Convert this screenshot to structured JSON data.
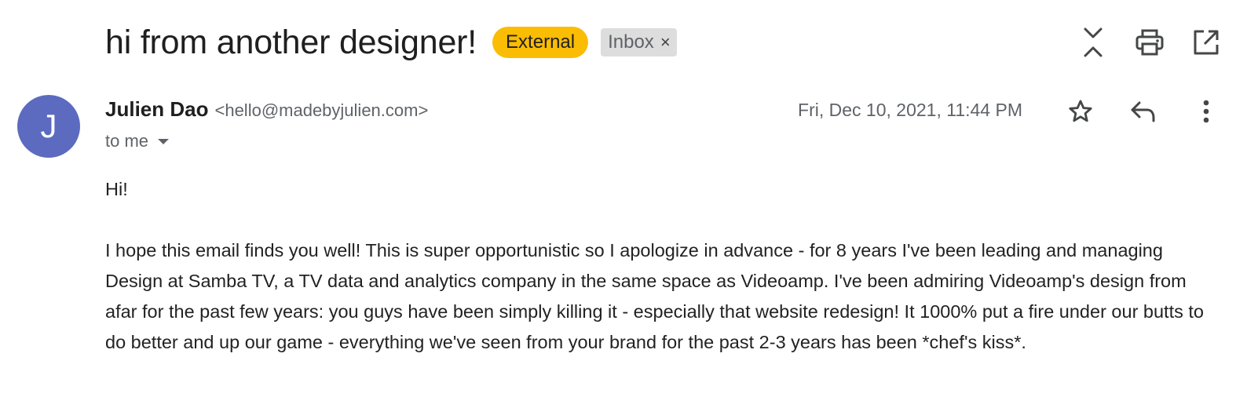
{
  "email": {
    "subject": "hi from another designer!",
    "labels": {
      "external": "External",
      "inbox": "Inbox",
      "remove": "×"
    },
    "sender": {
      "avatar_letter": "J",
      "name": "Julien Dao",
      "email": "<hello@madebyjulien.com>",
      "to": "to me"
    },
    "date": "Fri, Dec 10, 2021, 11:44 PM",
    "body": {
      "greeting": "Hi!",
      "paragraph": "I hope this email finds you well! This is super opportunistic so I apologize in advance - for 8 years I've been leading and managing Design at Samba TV, a TV data and analytics company in the same space as Videoamp. I've been admiring Videoamp's design from afar for the past few years: you guys have been simply killing it - especially that website redesign! It 1000% put a fire under our butts to do better and up our game - everything we've seen from your brand for the past 2-3 years has been *chef's kiss*."
    }
  },
  "icons": {
    "collapse": "collapse-all-icon",
    "print": "print-icon",
    "open_new_window": "open-in-new-window-icon",
    "star": "star-icon",
    "reply": "reply-icon",
    "more": "more-vert-icon",
    "dropdown": "chevron-down-icon"
  },
  "colors": {
    "external_badge": "#fbbc04",
    "inbox_badge": "#dddddd",
    "avatar": "#5c6bc0",
    "icon": "#444746"
  }
}
